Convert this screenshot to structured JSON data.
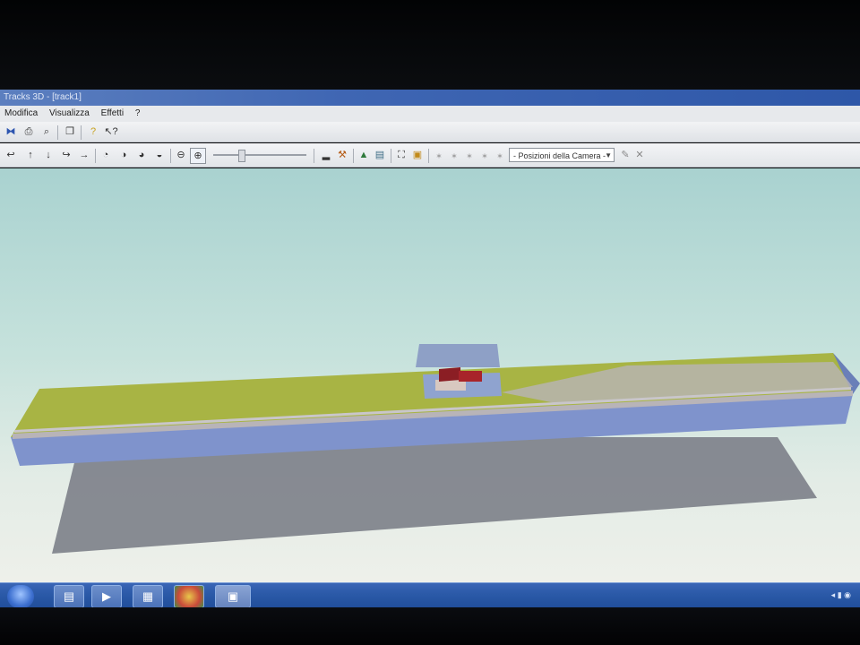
{
  "window": {
    "title": "Tracks 3D - [track1]"
  },
  "menu": {
    "items": [
      "Modifica",
      "Visualizza",
      "Effetti",
      "?"
    ]
  },
  "toolbar1": {
    "icons": [
      "rail-tool-icon",
      "print-icon",
      "print-preview-icon",
      "copy-icon",
      "help-icon",
      "context-help-icon"
    ]
  },
  "toolbar2": {
    "icons": [
      "rotate-left-icon",
      "move-up-icon",
      "move-down-icon",
      "rotate-right-icon",
      "move-right-icon",
      "view-1-icon",
      "view-2-icon",
      "view-3-icon",
      "view-4-icon",
      "zoom-out-icon",
      "zoom-in-icon"
    ],
    "camera_select": "- Posizioni della Camera -"
  },
  "colors": {
    "sky_top": "#a9d2d0",
    "grass": "#a8b444",
    "base_side": "#7f93cc",
    "rails": "#b8b4b8",
    "shadow": "#7c7f88",
    "house_roof": "#8b1e24",
    "taskbar": "#2b5aa8"
  },
  "taskbar": {
    "apps": [
      "explorer-icon",
      "media-icon",
      "video-icon",
      "chrome-icon",
      "tracks3d-icon"
    ]
  }
}
